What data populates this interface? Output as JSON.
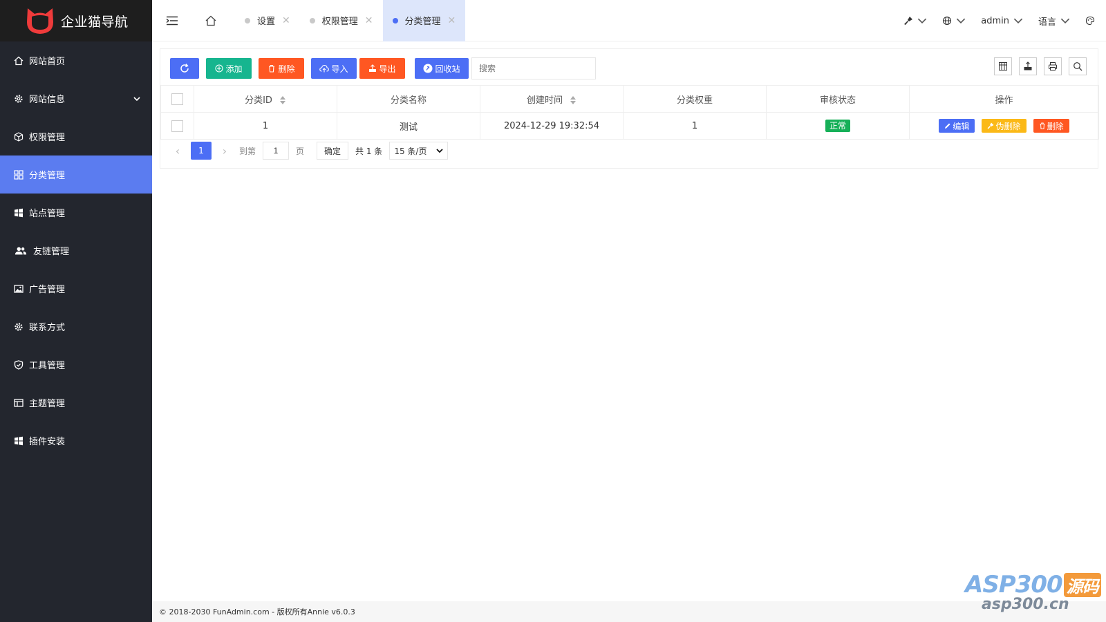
{
  "app": {
    "logo_text": "企业猫导航",
    "brand_color": "#ef3b3b"
  },
  "sidebar": {
    "items": [
      {
        "label": "网站首页",
        "icon": "home-icon"
      },
      {
        "label": "网站信息",
        "icon": "gear-icon"
      },
      {
        "label": "权限管理",
        "icon": "cube-icon"
      },
      {
        "label": "分类管理",
        "icon": "apps-icon",
        "active": true
      },
      {
        "label": "站点管理",
        "icon": "windows-icon"
      },
      {
        "label": "友链管理",
        "icon": "users-icon"
      },
      {
        "label": "广告管理",
        "icon": "image-icon"
      },
      {
        "label": "联系方式",
        "icon": "gear-icon"
      },
      {
        "label": "工具管理",
        "icon": "shield-icon"
      },
      {
        "label": "主题管理",
        "icon": "layout-icon"
      },
      {
        "label": "插件安装",
        "icon": "windows-icon"
      }
    ]
  },
  "header": {
    "tabs": [
      {
        "label": "设置",
        "active": false
      },
      {
        "label": "权限管理",
        "active": false
      },
      {
        "label": "分类管理",
        "active": true
      }
    ],
    "user": "admin",
    "language": "语言"
  },
  "toolbar": {
    "add": "添加",
    "delete": "删除",
    "import": "导入",
    "export": "导出",
    "recycle": "回收站",
    "search_placeholder": "搜索"
  },
  "table": {
    "columns": [
      "分类ID",
      "分类名称",
      "创建时间",
      "分类权重",
      "审核状态",
      "操作"
    ],
    "rows": [
      {
        "id": "1",
        "name": "测试",
        "created": "2024-12-29 19:32:54",
        "weight": "1",
        "status": "正常"
      }
    ],
    "actions": {
      "edit": "编辑",
      "fake_delete": "伪删除",
      "delete": "删除"
    }
  },
  "pager": {
    "current": "1",
    "goto_label": "到第",
    "goto_value": "1",
    "page_label": "页",
    "confirm": "确定",
    "total": "共 1 条",
    "per_page": "15 条/页"
  },
  "footer": {
    "text": "© 2018-2030 FunAdmin.com - 版权所有Annie v6.0.3"
  },
  "watermark": {
    "top": "ASP300",
    "top_badge": "源码",
    "bottom": "asp300.cn"
  },
  "colors": {
    "primary": "#4c6ef5",
    "success": "#16b58f",
    "danger": "#ff5722",
    "warning": "#fbb917",
    "sidebar_bg": "#23262e"
  }
}
